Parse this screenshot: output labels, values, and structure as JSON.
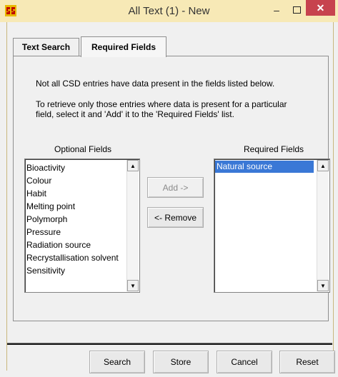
{
  "window": {
    "title": "All Text (1) - New",
    "controls": {
      "minimize": "–",
      "maximize": "□",
      "close": "✕"
    }
  },
  "tabs": [
    {
      "label": "Text Search",
      "active": false
    },
    {
      "label": "Required Fields",
      "active": true
    }
  ],
  "info": {
    "line1": "Not all CSD entries have data present in the fields listed below.",
    "line2": "To retrieve only those entries where data is present for a particular field, select it and 'Add' it to the 'Required Fields' list."
  },
  "optional": {
    "label": "Optional Fields",
    "items": [
      "Bioactivity",
      "Colour",
      "Habit",
      "Melting point",
      "Polymorph",
      "Pressure",
      "Radiation source",
      "Recrystallisation solvent",
      "Sensitivity"
    ]
  },
  "required": {
    "label": "Required Fields",
    "items": [
      "Natural source"
    ],
    "selected_index": 0
  },
  "buttons": {
    "add": "Add ->",
    "remove": "<- Remove",
    "search": "Search",
    "store": "Store",
    "cancel": "Cancel",
    "reset": "Reset"
  },
  "colors": {
    "titlebar": "#f7e9b6",
    "close": "#c7434e",
    "selection": "#3a78d6"
  },
  "icons": {
    "app": "app-logo-icon",
    "scroll_up": "scroll-up-arrow-icon",
    "scroll_down": "scroll-down-arrow-icon"
  }
}
